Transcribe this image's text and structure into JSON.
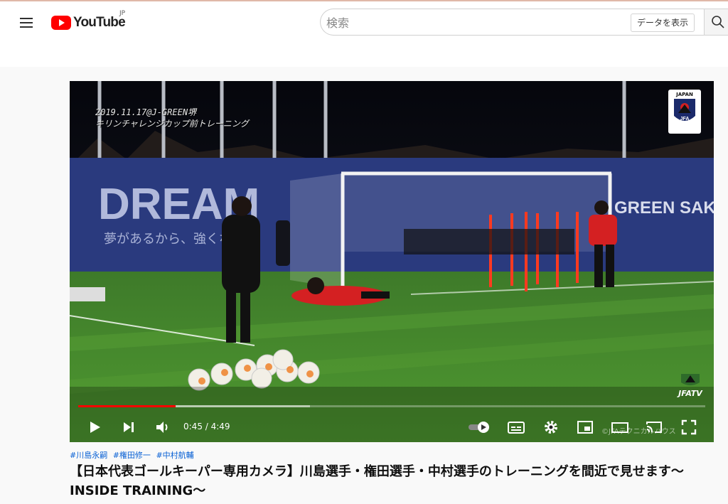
{
  "header": {
    "logo_text": "YouTube",
    "region": "JP",
    "search_placeholder": "検索",
    "data_button": "データを表示"
  },
  "video": {
    "overlay_date": "2019.11.17@J-GREEN堺",
    "overlay_text": "キリンチャレンジカップ前トレーニング",
    "banner_text": "DREAM",
    "banner_sub": "夢があるから、強くなる",
    "sponsor_text": "GREEN SAKAI",
    "badge_text": "JAPAN",
    "badge_logo": "JFA",
    "watermark": "JFATV",
    "current_time": "0:45",
    "duration": "4:49",
    "time_display": "0:45 / 4:49",
    "copyright": "©JFAテクニカルハウス",
    "progress_played": 0.155,
    "progress_loaded": 0.37
  },
  "hashtags": [
    "#川島永嗣",
    "#権田修一",
    "#中村航輔"
  ],
  "title": "【日本代表ゴールキーパー専用カメラ】川島選手・権田選手・中村選手のトレーニングを間近で見せます〜INSIDE TRAINING〜",
  "colors": {
    "accent": "#ff0000",
    "link": "#065fd4"
  }
}
